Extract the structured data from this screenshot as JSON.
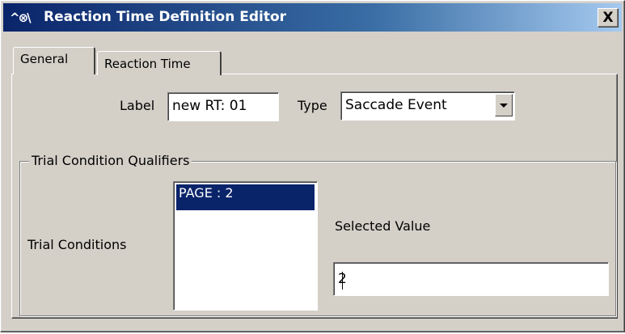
{
  "window": {
    "title": "Reaction Time Definition Editor",
    "icon_glyph": "^⊗\\",
    "close_glyph": "X"
  },
  "tabs": [
    {
      "label": "General",
      "active": true
    },
    {
      "label": "Reaction Time",
      "active": false
    }
  ],
  "general": {
    "label_caption": "Label",
    "label_value": "new RT: 01",
    "type_caption": "Type",
    "type_value": "Saccade Event"
  },
  "qualifiers": {
    "group_title": "Trial Condition Qualifiers",
    "trial_conditions_caption": "Trial Conditions",
    "trial_conditions_items": [
      "PAGE : 2"
    ],
    "selected_item": "PAGE : 2",
    "selected_value_caption": "Selected Value",
    "selected_value": "2"
  },
  "colors": {
    "titlebar_start": "#0a246a",
    "titlebar_end": "#a6caf0",
    "face": "#d4d0c8",
    "selection": "#0a246a"
  }
}
